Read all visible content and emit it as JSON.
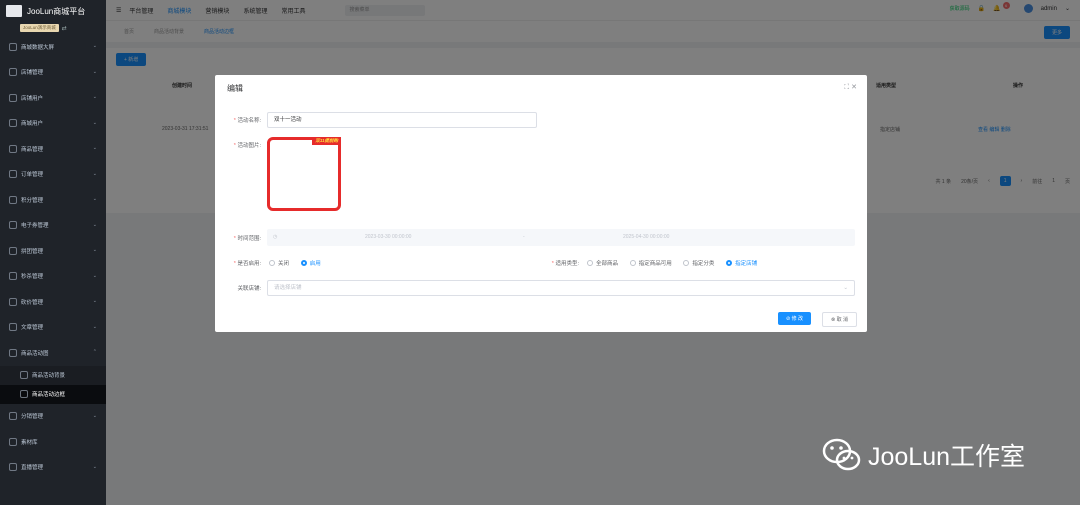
{
  "sidebar": {
    "app_title": "JooLun商城平台",
    "tenant_tag": "JooLun演示商城",
    "items": [
      {
        "label": "商城数据大屏"
      },
      {
        "label": "店铺管理"
      },
      {
        "label": "店铺用户"
      },
      {
        "label": "商城用户"
      },
      {
        "label": "商品管理"
      },
      {
        "label": "订单管理"
      },
      {
        "label": "积分管理"
      },
      {
        "label": "电子券管理"
      },
      {
        "label": "拼团管理"
      },
      {
        "label": "秒杀管理"
      },
      {
        "label": "砍价管理"
      },
      {
        "label": "文章管理"
      },
      {
        "label": "商品活动图"
      }
    ],
    "sub_items": [
      {
        "label": "商品活动背景"
      },
      {
        "label": "商品活动边框"
      }
    ],
    "after_items": [
      {
        "label": "分销管理"
      },
      {
        "label": "素材库"
      },
      {
        "label": "直播管理"
      }
    ]
  },
  "topbar": {
    "nav": [
      "平台管理",
      "商城模块",
      "营销模块",
      "系统管理",
      "常用工具"
    ],
    "active_nav": "商城模块",
    "search_placeholder": "搜索菜单",
    "status_text": "获取源码",
    "notification_count": "6",
    "user": "admin"
  },
  "tabs": [
    "首页",
    "商品活动背景",
    "商品活动边框"
  ],
  "more_label": "更多",
  "content": {
    "add_label": "+ 新增",
    "headers": [
      "创建时间",
      "适用类型",
      "操作"
    ],
    "row": {
      "created": "2023-03-31 17:31:51",
      "type": "指定店铺",
      "actions": "查看  编辑  删除"
    },
    "pager": {
      "total": "共 1 条",
      "per_page": "20条/页",
      "page": "1",
      "goto": "前往",
      "goto_page": "1",
      "page_suffix": "页"
    }
  },
  "modal": {
    "title": "编辑",
    "fields": {
      "name_label": "活动名称:",
      "name_value": "双十一活动",
      "image_label": "活动图片:",
      "image_ribbon": "双11提前购",
      "time_label": "时间范围:",
      "start": "2023-03-30 00:00:00",
      "sep": "-",
      "end": "2025-04-30 00:00:00",
      "enable_label": "是否启用:",
      "enable_options": [
        "关闭",
        "启用"
      ],
      "enable_selected": "启用",
      "type_label": "适用类型:",
      "type_options": [
        "全部商品",
        "指定商品可用",
        "指定分类",
        "指定店铺"
      ],
      "type_selected": "指定店铺",
      "store_label": "关联店铺:",
      "store_placeholder": "请选择店铺"
    },
    "confirm_label": "⊘ 修 改",
    "cancel_label": "⊗ 取 消"
  },
  "watermark": "JooLun工作室"
}
